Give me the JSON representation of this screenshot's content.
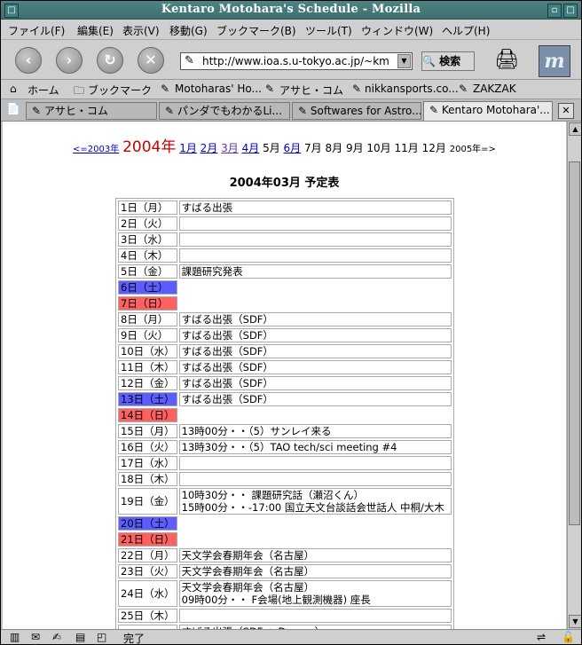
{
  "window": {
    "title": "Kentaro Motohara's Schedule - Mozilla"
  },
  "menubar": [
    "ファイル(F)",
    "編集(E)",
    "表示(V)",
    "移動(G)",
    "ブックマーク(B)",
    "ツール(T)",
    "ウィンドウ(W)",
    "ヘルプ(H)"
  ],
  "navbar": {
    "url": "http://www.ioa.s.u-tokyo.ac.jp/~kmotohara",
    "search_label": "🔍 検索"
  },
  "personal_toolbar": [
    "ホーム",
    "ブックマーク",
    "Motoharas' Ho...",
    "アサヒ・コム",
    "nikkansports.co...",
    "ZAKZAK"
  ],
  "tabs": [
    "アサヒ・コム",
    "パンダでもわかるLi...",
    "Softwares for Astro...",
    "Kentaro Motohara'..."
  ],
  "yearnav": {
    "prev": "<=2003年",
    "current": "2004年",
    "months": [
      {
        "label": "1月",
        "link": true
      },
      {
        "label": "2月",
        "link": true
      },
      {
        "label": "3月",
        "link": true
      },
      {
        "label": "4月",
        "link": true
      },
      {
        "label": "5月",
        "link": false
      },
      {
        "label": "6月",
        "link": true
      },
      {
        "label": "7月",
        "link": false
      },
      {
        "label": "8月",
        "link": false
      },
      {
        "label": "9月",
        "link": false
      },
      {
        "label": "10月",
        "link": false
      },
      {
        "label": "11月",
        "link": false
      },
      {
        "label": "12月",
        "link": false
      }
    ],
    "next": "2005年=>"
  },
  "page_title": "2004年03月 予定表",
  "schedule": [
    {
      "day": "1日（月）",
      "text": "すばる出張"
    },
    {
      "day": "2日（火）",
      "text": ""
    },
    {
      "day": "3日（水）",
      "text": ""
    },
    {
      "day": "4日（木）",
      "text": ""
    },
    {
      "day": "5日（金）",
      "text": "課題研究発表"
    },
    {
      "day": "6日（土）",
      "text": "",
      "type": "sat"
    },
    {
      "day": "7日（日）",
      "text": "",
      "type": "sun"
    },
    {
      "day": "8日（月）",
      "text": "すばる出張（SDF）"
    },
    {
      "day": "9日（火）",
      "text": "すばる出張（SDF）"
    },
    {
      "day": "10日（水）",
      "text": "すばる出張（SDF）"
    },
    {
      "day": "11日（木）",
      "text": "すばる出張（SDF）"
    },
    {
      "day": "12日（金）",
      "text": "すばる出張（SDF）"
    },
    {
      "day": "13日（土）",
      "text": "すばる出張（SDF）",
      "type": "sat"
    },
    {
      "day": "14日（日）",
      "text": "",
      "type": "sun"
    },
    {
      "day": "15日（月）",
      "text": "13時00分・・（5）サンレイ来る"
    },
    {
      "day": "16日（火）",
      "text": "13時30分・・（5）TAO tech/sci meeting #4"
    },
    {
      "day": "17日（水）",
      "text": ""
    },
    {
      "day": "18日（木）",
      "text": ""
    },
    {
      "day": "19日（金）",
      "text": "10時30分・・ 課題研究話（瀬沼くん）",
      "text2": "15時00分・・-17:00 国立天文台談話会世話人 中桐/大木"
    },
    {
      "day": "20日（土）",
      "text": "",
      "type": "sat"
    },
    {
      "day": "21日（日）",
      "text": "",
      "type": "sun"
    },
    {
      "day": "22日（月）",
      "text": "天文学会春期年会（名古屋）"
    },
    {
      "day": "23日（火）",
      "text": "天文学会春期年会（名古屋）"
    },
    {
      "day": "24日（水）",
      "text": "天文学会春期年会（名古屋）",
      "text2": "09時00分・・ F会場(地上観測機器) 座長"
    },
    {
      "day": "25日（木）",
      "text": ""
    },
    {
      "day": "",
      "text": "すばる出張（SDF + Deep...）"
    }
  ],
  "status": {
    "text": "完了"
  }
}
